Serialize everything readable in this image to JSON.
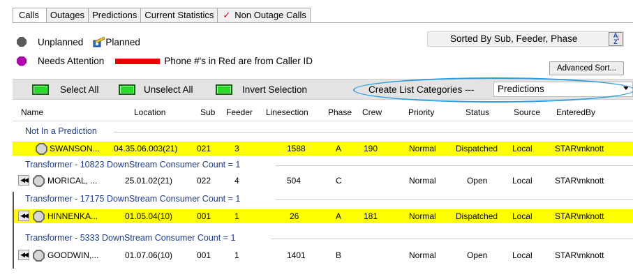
{
  "tabs": [
    {
      "label": "Calls"
    },
    {
      "label": "Outages"
    },
    {
      "label": "Predictions"
    },
    {
      "label": "Current Statistics"
    },
    {
      "label": "Non Outage Calls"
    }
  ],
  "legend": {
    "unplanned": "Unplanned",
    "planned": "Planned",
    "needs_attention": "Needs Attention",
    "phone_note": "Phone #'s in Red are from Caller ID"
  },
  "sort": {
    "label": "Sorted By Sub, Feeder, Phase",
    "advanced_button": "Advanced Sort..."
  },
  "selection": {
    "select_all": "Select All",
    "unselect_all": "Unselect All",
    "invert": "Invert Selection",
    "categories_label": "Create List Categories ---",
    "categories_value": "Predictions"
  },
  "columns": [
    "Name",
    "Location",
    "Sub",
    "Feeder",
    "Linesection",
    "Phase",
    "Crew",
    "Priority",
    "Status",
    "Source",
    "EnteredBy"
  ],
  "groups": [
    {
      "title": "Not In a Prediction",
      "rows": [
        {
          "name": "SWANSON...",
          "location": "04.35.06.003(21)",
          "sub": "021",
          "feeder": "3",
          "linesection": "1588",
          "phase": "A",
          "crew": "190",
          "priority": "Normal",
          "status": "Dispatched",
          "source": "Local",
          "entered_by": "STAR\\mknott"
        }
      ]
    },
    {
      "title": "Transformer - 10823   DownStream Consumer Count = 1",
      "rows": [
        {
          "name": "MORICAL, ...",
          "location": "25.01.02(21)",
          "sub": "022",
          "feeder": "4",
          "linesection": "504",
          "phase": "C",
          "crew": "",
          "priority": "Normal",
          "status": "Open",
          "source": "Local",
          "entered_by": "STAR\\mknott"
        }
      ]
    },
    {
      "title": "Transformer - 17175   DownStream Consumer Count = 1",
      "rows": [
        {
          "name": "HINNENKA...",
          "location": "01.05.04(10)",
          "sub": "001",
          "feeder": "1",
          "linesection": "26",
          "phase": "A",
          "crew": "181",
          "priority": "Normal",
          "status": "Dispatched",
          "source": "Local",
          "entered_by": "STAR\\mknott"
        }
      ]
    },
    {
      "title": "Transformer - 5333   DownStream Consumer Count = 1",
      "rows": [
        {
          "name": "GOODWIN,...",
          "location": "01.07.06(10)",
          "sub": "001",
          "feeder": "1",
          "linesection": "1401",
          "phase": "B",
          "crew": "",
          "priority": "Normal",
          "status": "Open",
          "source": "Local",
          "entered_by": "STAR\\mknott"
        }
      ]
    }
  ],
  "colors": {
    "highlight": "#ffff00",
    "group_text": "#1f3d8f",
    "ellipse": "#2a9ee0",
    "caller_id_red": "#ee0000"
  }
}
